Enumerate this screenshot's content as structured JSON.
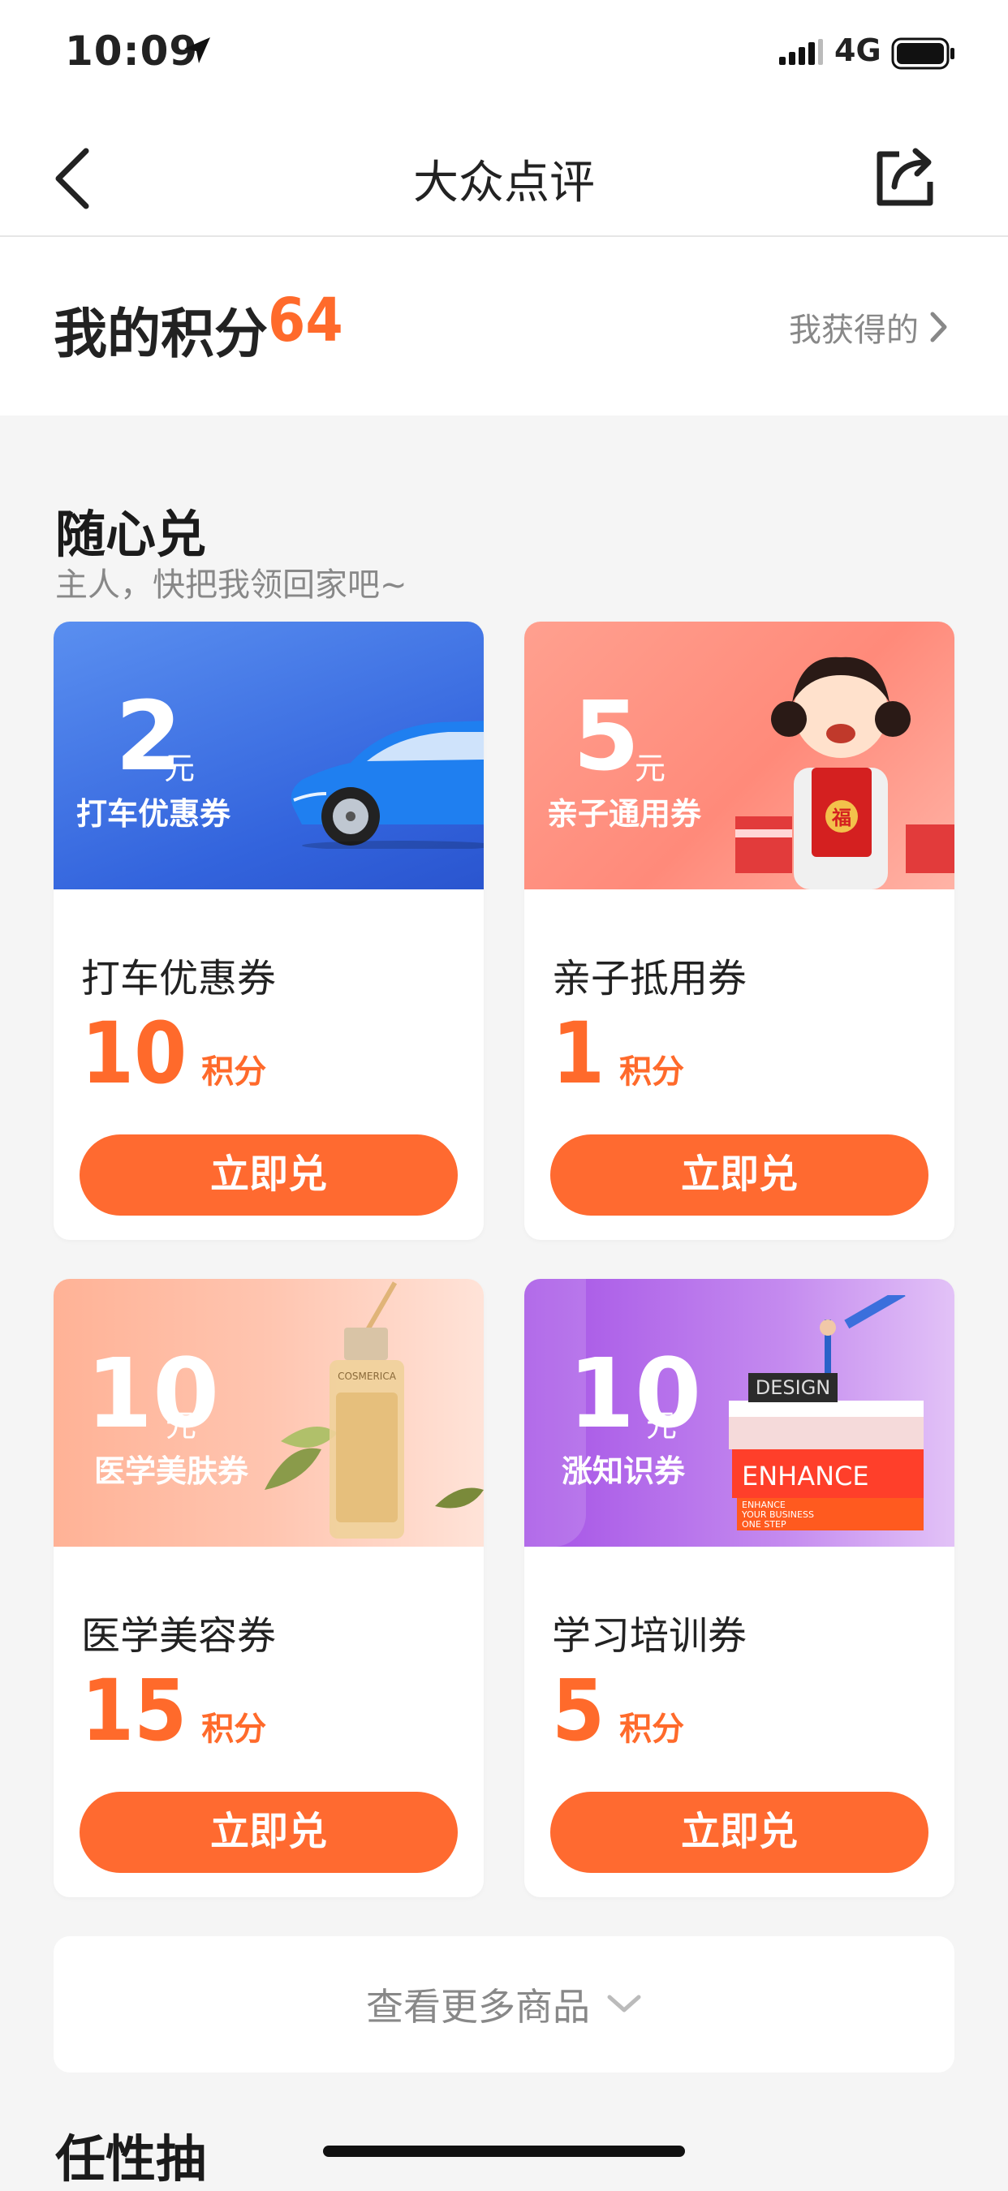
{
  "status_bar": {
    "time": "10:09",
    "network": "4G"
  },
  "nav": {
    "title": "大众点评"
  },
  "points": {
    "label": "我的积分",
    "value": "64",
    "earned_link": "我获得的"
  },
  "section": {
    "title": "随心兑",
    "subtitle": "主人，快把我领回家吧~"
  },
  "cards": [
    {
      "banner_amount": "2",
      "banner_unit": "元",
      "banner_caption": "打车优惠券",
      "name": "打车优惠券",
      "points": "10",
      "points_unit": "积分",
      "button": "立即兑",
      "banner_colors": [
        "#4f86ea",
        "#2f5fdc"
      ]
    },
    {
      "banner_amount": "5",
      "banner_unit": "元",
      "banner_caption": "亲子通用券",
      "name": "亲子抵用券",
      "points": "1",
      "points_unit": "积分",
      "button": "立即兑",
      "banner_colors": [
        "#ff9a8a",
        "#ff7b6e"
      ]
    },
    {
      "banner_amount": "10",
      "banner_unit": "元",
      "banner_caption": "医学美肤券",
      "name": "医学美容券",
      "points": "15",
      "points_unit": "积分",
      "button": "立即兑",
      "banner_colors": [
        "#ffb49a",
        "#ffd7c7"
      ]
    },
    {
      "banner_amount": "10",
      "banner_unit": "元",
      "banner_caption": "涨知识券",
      "name": "学习培训券",
      "points": "5",
      "points_unit": "积分",
      "button": "立即兑",
      "banner_colors": [
        "#a95be9",
        "#d6a6f4"
      ]
    }
  ],
  "banner_text": {
    "book_top": "DESIGN",
    "book_mid": "ENHANCE",
    "book_small1": "ENHANCE",
    "book_small2": "YOUR BUSINESS",
    "book_small3": "ONE STEP",
    "bottle": "COSMERICA",
    "fu": "福"
  },
  "more": {
    "label": "查看更多商品"
  },
  "section2": {
    "title": "任性抽"
  },
  "colors": {
    "accent": "#ff6a2b",
    "button": "#ff6a30"
  }
}
